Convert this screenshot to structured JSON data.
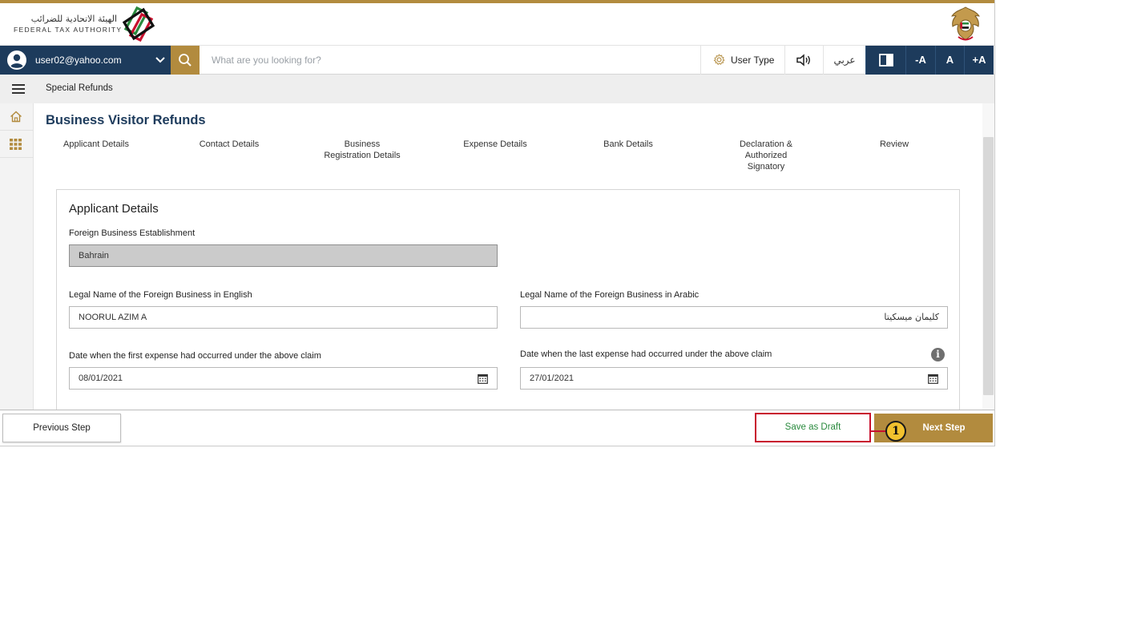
{
  "header": {
    "org_name_ar": "الهيئة الاتحادية للضرائب",
    "org_name_en": "FEDERAL TAX AUTHORITY"
  },
  "nav": {
    "user_email": "user02@yahoo.com",
    "search_placeholder": "What are you looking for?",
    "user_type_label": "User Type",
    "language_label": "عربي",
    "font_decrease": "-A",
    "font_normal": "A",
    "font_increase": "+A"
  },
  "breadcrumb": "Special Refunds",
  "page_title": "Business Visitor Refunds",
  "steps": [
    {
      "label": "Applicant Details"
    },
    {
      "label": "Contact Details"
    },
    {
      "label": "Business\nRegistration Details"
    },
    {
      "label": "Expense Details"
    },
    {
      "label": "Bank Details"
    },
    {
      "label": "Declaration &\nAuthorized\nSignatory"
    },
    {
      "label": "Review"
    }
  ],
  "form": {
    "section_title": "Applicant Details",
    "establishment": {
      "label": "Foreign Business Establishment",
      "value": "Bahrain"
    },
    "legal_name_en": {
      "label": "Legal Name of the Foreign Business in English",
      "value": "NOORUL AZIM A"
    },
    "legal_name_ar": {
      "label": "Legal Name of the Foreign Business in Arabic",
      "value": "كليمان ميسكيتا"
    },
    "first_expense": {
      "label": "Date when the first expense had occurred under the above claim",
      "value": "08/01/2021"
    },
    "last_expense": {
      "label": "Date when the last expense had occurred under the above claim",
      "value": "27/01/2021"
    },
    "info_glyph": "i"
  },
  "footer": {
    "previous_label": "Previous Step",
    "draft_label": "Save as Draft",
    "next_label": "Next Step",
    "callout_number": "1"
  },
  "colors": {
    "brand_gold": "#b28b3e",
    "brand_navy": "#1d3b5c",
    "highlight_red": "#c8102e",
    "callout_yellow": "#f2c12e"
  }
}
